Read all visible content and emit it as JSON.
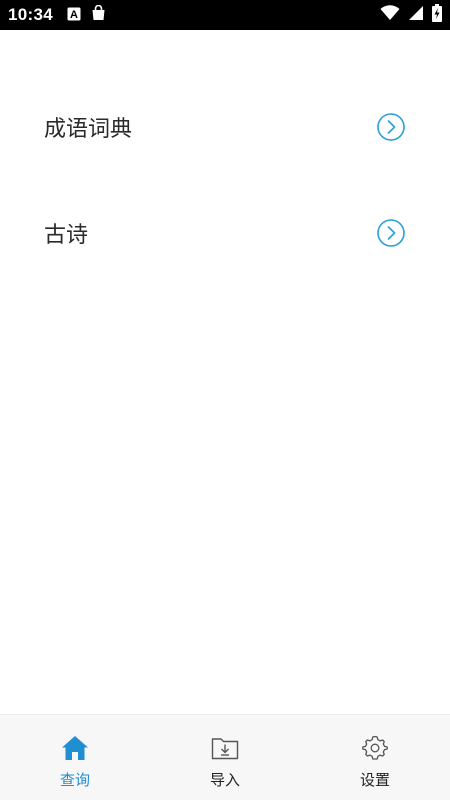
{
  "status_bar": {
    "time": "10:34",
    "left_icons": [
      "keyboard-a-icon",
      "shopping-bag-icon"
    ],
    "right_icons": [
      "wifi-icon",
      "signal-icon",
      "battery-charging-icon"
    ]
  },
  "list": {
    "items": [
      {
        "label": "成语词典",
        "icon": "chevron-right-circle-icon"
      },
      {
        "label": "古诗",
        "icon": "chevron-right-circle-icon"
      }
    ]
  },
  "bottom_nav": {
    "items": [
      {
        "label": "查询",
        "icon": "home-icon",
        "active": true
      },
      {
        "label": "导入",
        "icon": "folder-import-icon",
        "active": false
      },
      {
        "label": "设置",
        "icon": "settings-gear-icon",
        "active": false
      }
    ]
  },
  "colors": {
    "accent": "#1f8fd1",
    "chevron": "#2a9fd8",
    "status_bar_bg": "#000000",
    "nav_bg": "#f7f7f7"
  }
}
